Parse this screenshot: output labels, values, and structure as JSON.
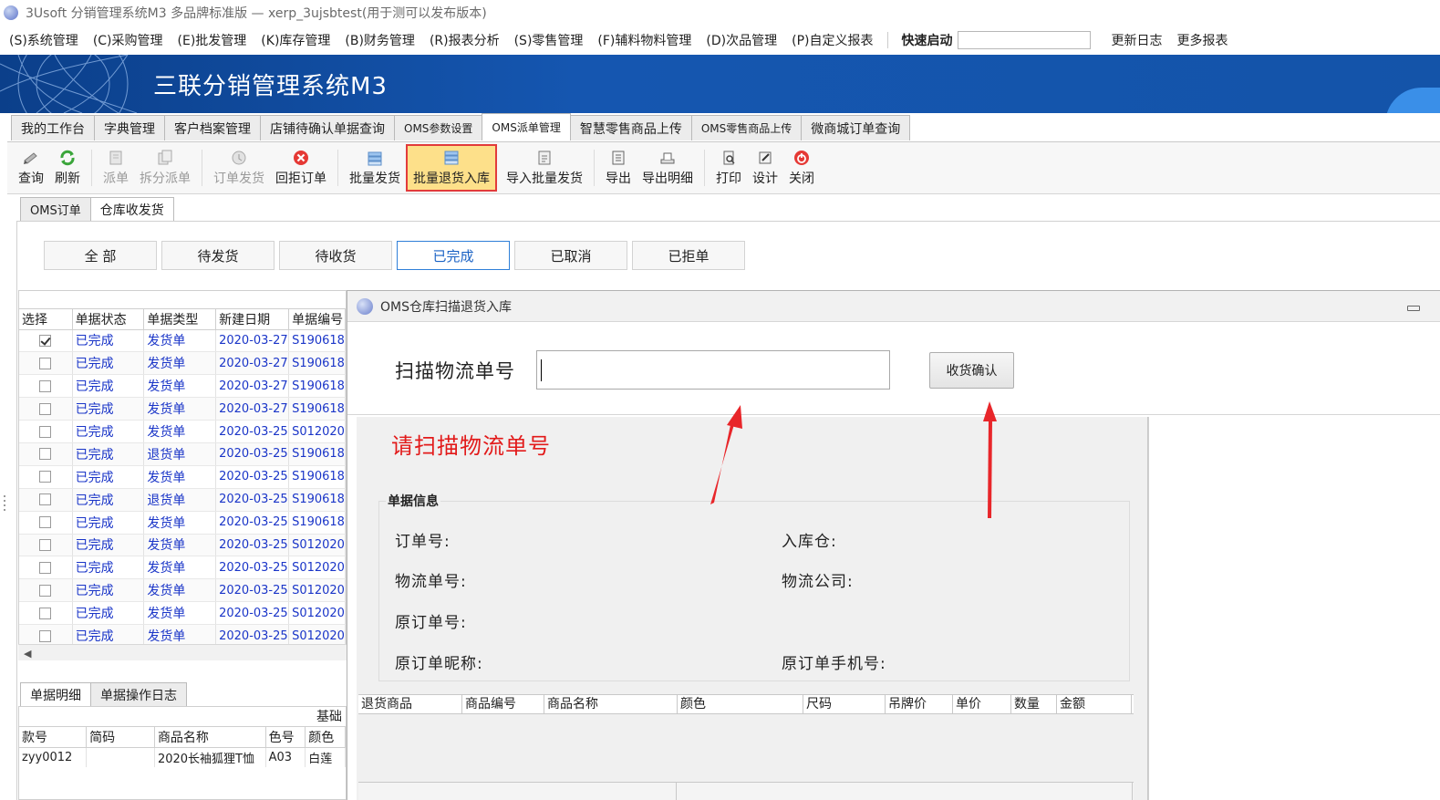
{
  "window": {
    "title": "3Usoft 分销管理系统M3 多品牌标准版 — xerp_3ujsbtest(用于测可以发布版本)"
  },
  "menubar": {
    "items": [
      {
        "label": "(S)系统管理"
      },
      {
        "label": "(C)采购管理"
      },
      {
        "label": "(E)批发管理"
      },
      {
        "label": "(K)库存管理"
      },
      {
        "label": "(B)财务管理"
      },
      {
        "label": "(R)报表分析"
      },
      {
        "label": "(S)零售管理"
      },
      {
        "label": "(F)辅料物料管理"
      },
      {
        "label": "(D)次品管理"
      },
      {
        "label": "(P)自定义报表"
      }
    ],
    "quick_start_label": "快速启动",
    "quick_start_value": "",
    "update_log": "更新日志",
    "more_reports": "更多报表"
  },
  "banner": {
    "logo_text": "三联分销管理系统M3"
  },
  "main_tabs": [
    {
      "label": "我的工作台"
    },
    {
      "label": "字典管理"
    },
    {
      "label": "客户档案管理"
    },
    {
      "label": "店铺待确认单据查询"
    },
    {
      "label": "OMS参数设置"
    },
    {
      "label": "OMS派单管理"
    },
    {
      "label": "智慧零售商品上传"
    },
    {
      "label": "OMS零售商品上传"
    },
    {
      "label": "微商城订单查询"
    }
  ],
  "toolbar": {
    "buttons": [
      {
        "label": "查询",
        "icon": "query-icon"
      },
      {
        "label": "刷新",
        "icon": "refresh-icon"
      },
      {
        "label": "派单",
        "icon": "dispatch-icon"
      },
      {
        "label": "拆分派单",
        "icon": "split-dispatch-icon"
      },
      {
        "label": "订单发货",
        "icon": "order-ship-icon"
      },
      {
        "label": "回拒订单",
        "icon": "reject-order-icon"
      },
      {
        "label": "批量发货",
        "icon": "batch-ship-icon"
      },
      {
        "label": "批量退货入库",
        "icon": "batch-return-icon"
      },
      {
        "label": "导入批量发货",
        "icon": "import-ship-icon"
      },
      {
        "label": "导出",
        "icon": "export-icon"
      },
      {
        "label": "导出明细",
        "icon": "export-detail-icon"
      },
      {
        "label": "打印",
        "icon": "print-icon"
      },
      {
        "label": "设计",
        "icon": "design-icon"
      },
      {
        "label": "关闭",
        "icon": "close-icon"
      }
    ]
  },
  "sub_tabs": [
    {
      "label": "OMS订单"
    },
    {
      "label": "仓库收发货"
    }
  ],
  "filters": [
    {
      "label": "全 部"
    },
    {
      "label": "待发货"
    },
    {
      "label": "待收货"
    },
    {
      "label": "已完成"
    },
    {
      "label": "已取消"
    },
    {
      "label": "已拒单"
    }
  ],
  "grid": {
    "columns": [
      "选择",
      "单据状态",
      "单据类型",
      "新建日期",
      "单据编号"
    ],
    "rows": [
      {
        "checked": true,
        "status": "已完成",
        "type": "发货单",
        "date": "2020-03-27",
        "number": "S190618"
      },
      {
        "checked": false,
        "status": "已完成",
        "type": "发货单",
        "date": "2020-03-27",
        "number": "S190618"
      },
      {
        "checked": false,
        "status": "已完成",
        "type": "发货单",
        "date": "2020-03-27",
        "number": "S190618"
      },
      {
        "checked": false,
        "status": "已完成",
        "type": "发货单",
        "date": "2020-03-27",
        "number": "S190618"
      },
      {
        "checked": false,
        "status": "已完成",
        "type": "发货单",
        "date": "2020-03-25",
        "number": "S012020"
      },
      {
        "checked": false,
        "status": "已完成",
        "type": "退货单",
        "date": "2020-03-25",
        "number": "S190618"
      },
      {
        "checked": false,
        "status": "已完成",
        "type": "发货单",
        "date": "2020-03-25",
        "number": "S190618"
      },
      {
        "checked": false,
        "status": "已完成",
        "type": "退货单",
        "date": "2020-03-25",
        "number": "S190618"
      },
      {
        "checked": false,
        "status": "已完成",
        "type": "发货单",
        "date": "2020-03-25",
        "number": "S190618"
      },
      {
        "checked": false,
        "status": "已完成",
        "type": "发货单",
        "date": "2020-03-25",
        "number": "S012020"
      },
      {
        "checked": false,
        "status": "已完成",
        "type": "发货单",
        "date": "2020-03-25",
        "number": "S012020"
      },
      {
        "checked": false,
        "status": "已完成",
        "type": "发货单",
        "date": "2020-03-25",
        "number": "S012020"
      },
      {
        "checked": false,
        "status": "已完成",
        "type": "发货单",
        "date": "2020-03-25",
        "number": "S012020"
      },
      {
        "checked": false,
        "status": "已完成",
        "type": "发货单",
        "date": "2020-03-25",
        "number": "S012020"
      }
    ]
  },
  "bottom_tabs": [
    {
      "label": "单据明细"
    },
    {
      "label": "单据操作日志"
    }
  ],
  "detail_grid": {
    "group_header": "基础",
    "columns": [
      "款号",
      "简码",
      "商品名称",
      "色号",
      "颜色"
    ],
    "rows": [
      {
        "style": "zyy0012",
        "code": "",
        "name": "2020长袖狐狸T恤",
        "color_no": "A03",
        "color": "白莲"
      }
    ]
  },
  "dialog": {
    "title": "OMS仓库扫描退货入库",
    "scan_label": "扫描物流单号",
    "scan_value": "",
    "confirm_button": "收货确认",
    "hint": "请扫描物流单号",
    "fieldset_legend": "单据信息",
    "fields": {
      "order_no": "订单号:",
      "warehouse": "入库仓:",
      "logistics_no": "物流单号:",
      "logistics_company": "物流公司:",
      "orig_order_no": "原订单号:",
      "orig_nickname": "原订单昵称:",
      "orig_phone": "原订单手机号:"
    },
    "goods_columns": [
      "退货商品",
      "商品编号",
      "商品名称",
      "颜色",
      "尺码",
      "吊牌价",
      "单价",
      "数量",
      "金额"
    ]
  },
  "colors": {
    "banner": "#1454a9",
    "highlight_border": "#e23b3b",
    "highlight_fill": "#fde08a",
    "link_blue": "#1a35c8",
    "hint_red": "#e21a1a",
    "annotation_arrow": "#e8262a"
  }
}
